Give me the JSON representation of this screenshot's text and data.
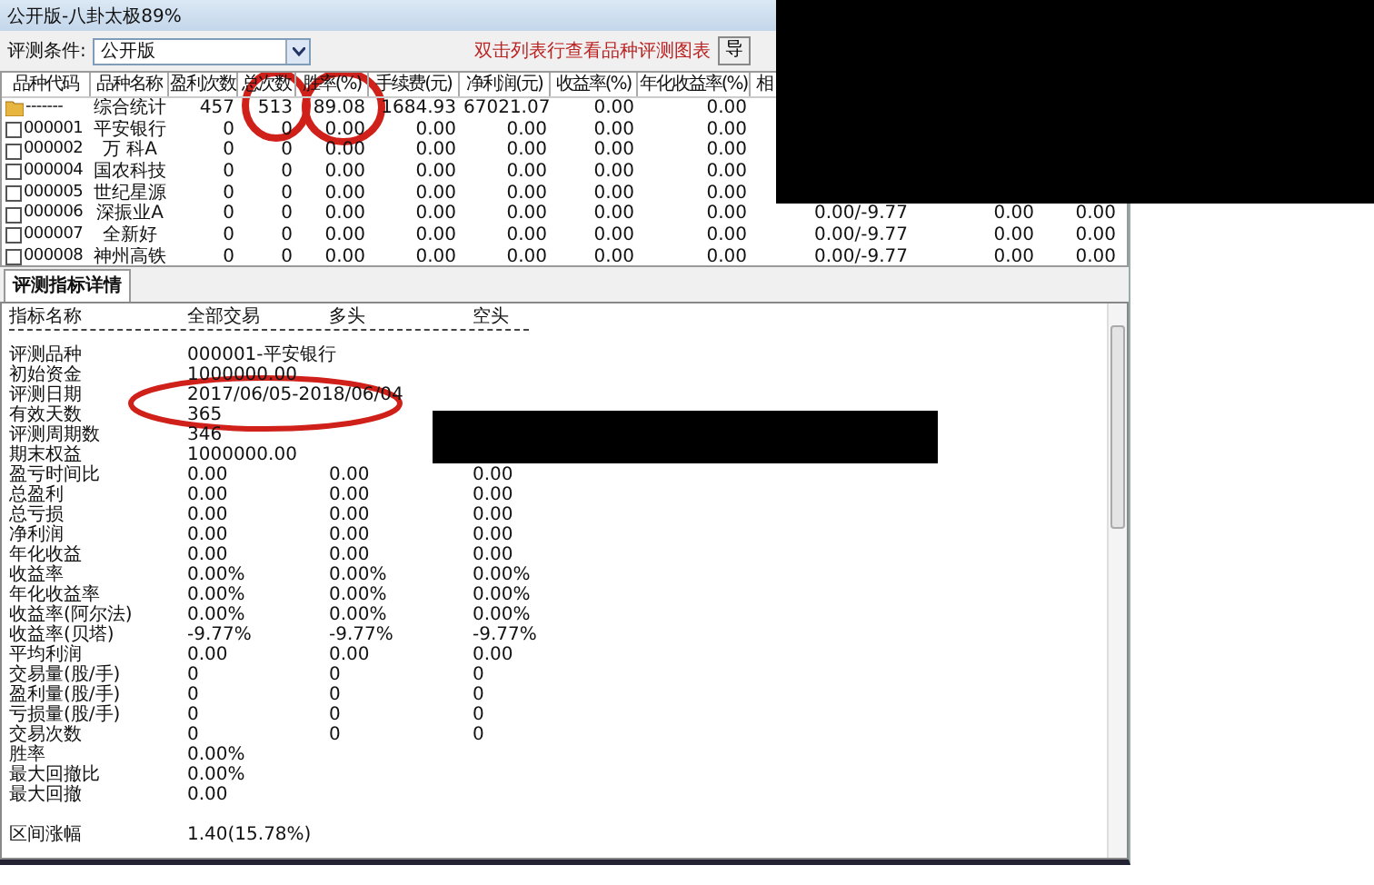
{
  "window": {
    "title": "公开版-八卦太极89%"
  },
  "filter": {
    "label": "评测条件:",
    "value": "公开版"
  },
  "hint": "双击列表行查看品种评测图表",
  "export_button": "导",
  "table": {
    "columns": [
      "品种代码",
      "品种名称",
      "盈利次数",
      "总次数",
      "胜率(%)",
      "手续费(元)",
      "净利润(元)",
      "收益率(%)",
      "年化收益率(%)",
      "相"
    ],
    "rows": [
      {
        "kind": "summary",
        "cells": [
          "-------",
          "综合统计",
          "457",
          "513",
          "89.08",
          "1684.93",
          "67021.07",
          "0.00",
          "0.00"
        ]
      },
      {
        "kind": "stock",
        "checked": false,
        "cells": [
          "000001",
          "平安银行",
          "0",
          "0",
          "0.00",
          "0.00",
          "0.00",
          "0.00",
          "0.00"
        ]
      },
      {
        "kind": "stock",
        "checked": false,
        "cells": [
          "000002",
          "万 科A",
          "0",
          "0",
          "0.00",
          "0.00",
          "0.00",
          "0.00",
          "0.00"
        ]
      },
      {
        "kind": "stock",
        "checked": false,
        "cells": [
          "000004",
          "国农科技",
          "0",
          "0",
          "0.00",
          "0.00",
          "0.00",
          "0.00",
          "0.00"
        ]
      },
      {
        "kind": "stock",
        "checked": false,
        "cells": [
          "000005",
          "世纪星源",
          "0",
          "0",
          "0.00",
          "0.00",
          "0.00",
          "0.00",
          "0.00"
        ]
      },
      {
        "kind": "stock",
        "checked": false,
        "cells": [
          "000006",
          "深振业A",
          "0",
          "0",
          "0.00",
          "0.00",
          "0.00",
          "0.00",
          "0.00"
        ],
        "extra": [
          "0.00/-9.77",
          "0.00",
          "0.00"
        ]
      },
      {
        "kind": "stock",
        "checked": false,
        "cells": [
          "000007",
          "全新好",
          "0",
          "0",
          "0.00",
          "0.00",
          "0.00",
          "0.00",
          "0.00"
        ],
        "extra": [
          "0.00/-9.77",
          "0.00",
          "0.00"
        ]
      },
      {
        "kind": "stock",
        "checked": false,
        "cells": [
          "000008",
          "神州高铁",
          "0",
          "0",
          "0.00",
          "0.00",
          "0.00",
          "0.00",
          "0.00"
        ],
        "extra": [
          "0.00/-9.77",
          "0.00",
          "0.00"
        ]
      }
    ]
  },
  "detail": {
    "tab": {
      "label": "评测指标详情",
      "selected": true
    },
    "columns": [
      "指标名称",
      "全部交易",
      "多头",
      "空头"
    ],
    "rows": [
      {
        "cells": [
          "评测品种",
          "000001-平安银行"
        ]
      },
      {
        "cells": [
          "初始资金",
          "1000000.00"
        ]
      },
      {
        "cells": [
          "评测日期",
          "2017/06/05-2018/06/04"
        ]
      },
      {
        "cells": [
          "有效天数",
          "365"
        ]
      },
      {
        "cells": [
          "评测周期数",
          "346"
        ]
      },
      {
        "cells": [
          "期末权益",
          "1000000.00"
        ]
      },
      {
        "cells": [
          "盈亏时间比",
          "0.00",
          "0.00",
          "0.00"
        ]
      },
      {
        "cells": [
          "总盈利",
          "0.00",
          "0.00",
          "0.00"
        ]
      },
      {
        "cells": [
          "总亏损",
          "0.00",
          "0.00",
          "0.00"
        ]
      },
      {
        "cells": [
          "净利润",
          "0.00",
          "0.00",
          "0.00"
        ]
      },
      {
        "cells": [
          "年化收益",
          "0.00",
          "0.00",
          "0.00"
        ]
      },
      {
        "cells": [
          "收益率",
          "0.00%",
          "0.00%",
          "0.00%"
        ]
      },
      {
        "cells": [
          "年化收益率",
          "0.00%",
          "0.00%",
          "0.00%"
        ]
      },
      {
        "cells": [
          "收益率(阿尔法)",
          "0.00%",
          "0.00%",
          "0.00%"
        ]
      },
      {
        "cells": [
          "收益率(贝塔)",
          "-9.77%",
          "-9.77%",
          "-9.77%"
        ]
      },
      {
        "cells": [
          "平均利润",
          "0.00",
          "0.00",
          "0.00"
        ]
      },
      {
        "cells": [
          "交易量(股/手)",
          "0",
          "0",
          "0"
        ]
      },
      {
        "cells": [
          "盈利量(股/手)",
          "0",
          "0",
          "0"
        ]
      },
      {
        "cells": [
          "亏损量(股/手)",
          "0",
          "0",
          "0"
        ]
      },
      {
        "cells": [
          "交易次数",
          "0",
          "0",
          "0"
        ]
      },
      {
        "cells": [
          "胜率",
          "0.00%"
        ]
      },
      {
        "cells": [
          "最大回撤比",
          "0.00%"
        ]
      },
      {
        "cells": [
          "最大回撤",
          "0.00"
        ]
      },
      {
        "kind": "spacer"
      },
      {
        "cells": [
          "区间涨幅",
          "1.40(15.78%)"
        ]
      }
    ]
  }
}
